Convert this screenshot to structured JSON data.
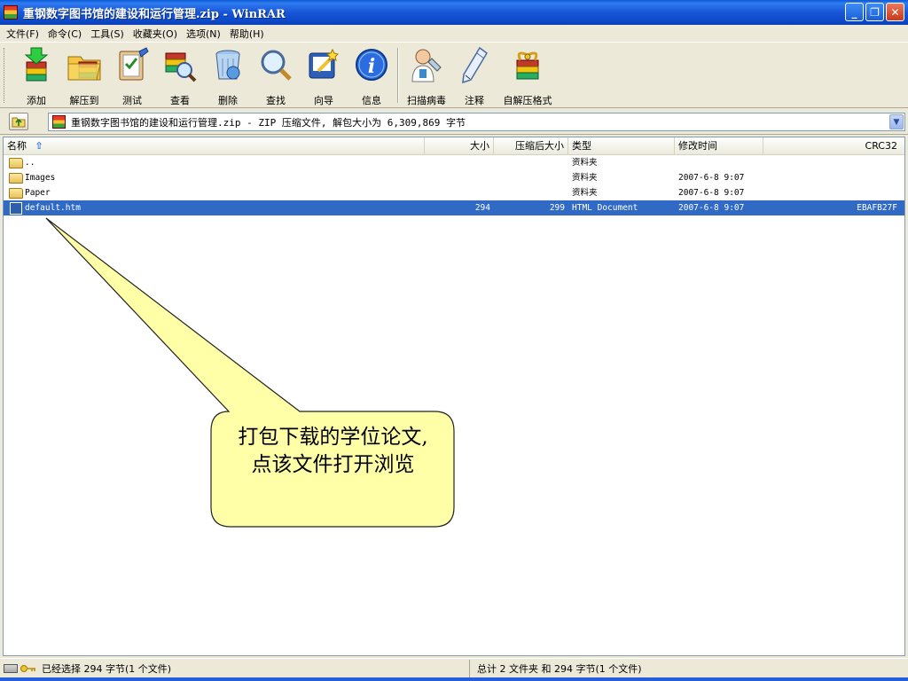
{
  "window": {
    "title": "重钢数字图书馆的建设和运行管理.zip - WinRAR",
    "minimize": "_",
    "restore": "❐",
    "close": "✕"
  },
  "menu": [
    "文件(F)",
    "命令(C)",
    "工具(S)",
    "收藏夹(O)",
    "选项(N)",
    "帮助(H)"
  ],
  "toolbar": [
    {
      "label": "添加",
      "icon": "add-icon"
    },
    {
      "label": "解压到",
      "icon": "extract-to-icon"
    },
    {
      "label": "测试",
      "icon": "test-icon"
    },
    {
      "label": "查看",
      "icon": "view-icon"
    },
    {
      "label": "删除",
      "icon": "delete-icon"
    },
    {
      "label": "查找",
      "icon": "find-icon"
    },
    {
      "label": "向导",
      "icon": "wizard-icon"
    },
    {
      "label": "信息",
      "icon": "info-icon"
    },
    {
      "label": "扫描病毒",
      "icon": "virus-scan-icon"
    },
    {
      "label": "注释",
      "icon": "comment-icon"
    },
    {
      "label": "自解压格式",
      "icon": "sfx-icon"
    }
  ],
  "address": {
    "text": "重钢数字图书馆的建设和运行管理.zip - ZIP 压缩文件, 解包大小为 6,309,869 字节"
  },
  "columns": {
    "name": "名称",
    "size": "大小",
    "packed": "压缩后大小",
    "type": "类型",
    "modified": "修改时间",
    "crc": "CRC32"
  },
  "files": [
    {
      "name": "..",
      "size": "",
      "packed": "",
      "type": "资料夹",
      "modified": "",
      "crc": "",
      "kind": "folder",
      "selected": false
    },
    {
      "name": "Images",
      "size": "",
      "packed": "",
      "type": "资料夹",
      "modified": "2007-6-8 9:07",
      "crc": "",
      "kind": "folder",
      "selected": false
    },
    {
      "name": "Paper",
      "size": "",
      "packed": "",
      "type": "资料夹",
      "modified": "2007-6-8 9:07",
      "crc": "",
      "kind": "folder",
      "selected": false
    },
    {
      "name": "default.htm",
      "size": "294",
      "packed": "299",
      "type": "HTML Document",
      "modified": "2007-6-8 9:07",
      "crc": "EBAFB27F",
      "kind": "file",
      "selected": true
    }
  ],
  "callout": {
    "line1": "打包下载的学位论文,",
    "line2": "点该文件打开浏览",
    "fill": "#ffffa8"
  },
  "status": {
    "left": "已经选择 294 字节(1 个文件)",
    "right": "总计 2 文件夹 和 294 字节(1 个文件)"
  },
  "colors": {
    "selection": "#316ac5",
    "titlebar": "#1856d8"
  }
}
